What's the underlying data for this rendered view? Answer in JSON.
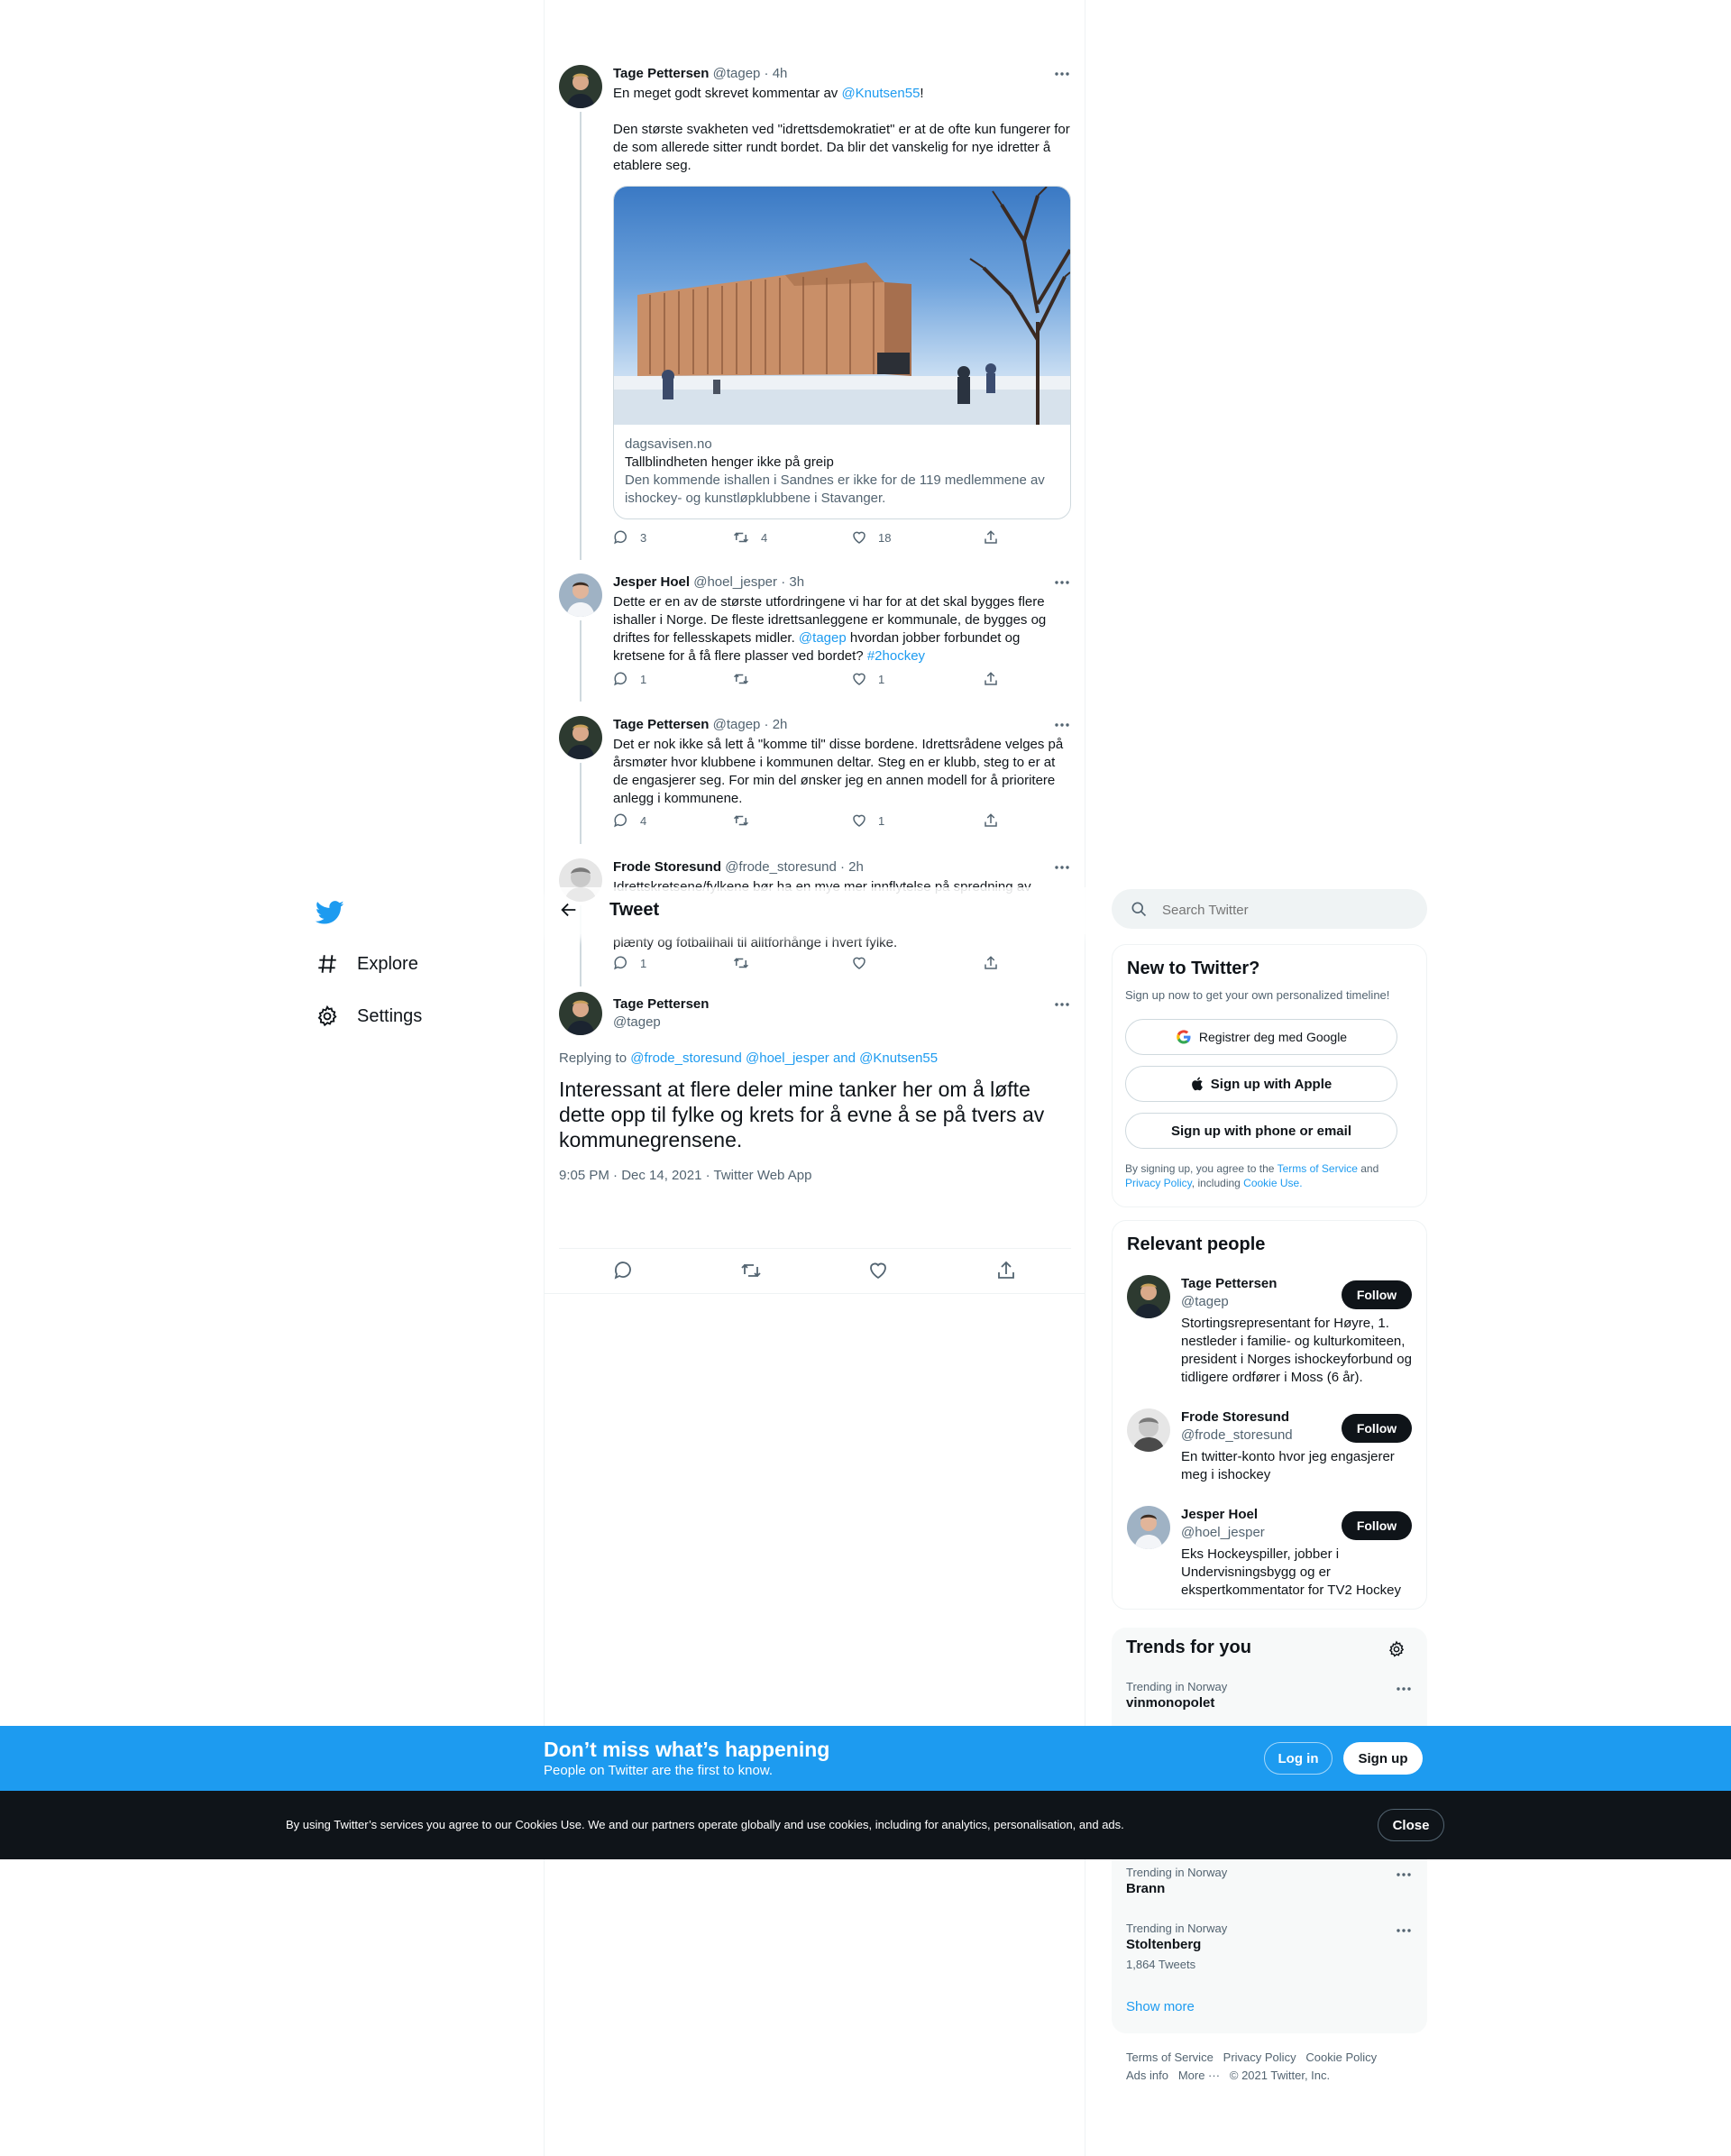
{
  "nav": {
    "logo": "twitter-bird-icon",
    "items": [
      {
        "label": "Explore",
        "icon": "hashtag-icon"
      },
      {
        "label": "Settings",
        "icon": "gear-icon"
      }
    ]
  },
  "header": {
    "title": "Tweet"
  },
  "thread": [
    {
      "name": "Tage Pettersen",
      "handle": "@tagep",
      "time": "· 4h",
      "text_before": "En meget godt skrevet kommentar av ",
      "mention": "@Knutsen55",
      "text_after": "!\n\nDen største svakheten ved \"idrettsdemokratiet\" er at de ofte kun fungerer for de som allerede sitter rundt bordet. Da blir det vanskelig for nye idretter å etablere seg.",
      "card": {
        "domain": "dagsavisen.no",
        "title": "Tallblindheten henger ikke på greip",
        "description": "Den kommende ishallen i Sandnes er ikke for de 119 medlemmene av ishockey- og kunstløpklubbene i Stavanger."
      },
      "replies": "3",
      "retweets": "4",
      "likes": "18"
    },
    {
      "name": "Jesper Hoel",
      "handle": "@hoel_jesper",
      "time": "· 3h",
      "text_before": "Dette er en av de største utfordringene vi har for at det skal bygges flere ishaller i Norge. De fleste idrettsanleggene er kommunale, de bygges og driftes for fellesskapets midler. ",
      "mention": "@tagep",
      "text_mid": " hvordan jobber forbundet og kretsene for å få flere plasser ved bordet? ",
      "hashtag": "#2hockey",
      "replies": "1",
      "retweets": "",
      "likes": "1"
    },
    {
      "name": "Tage Pettersen",
      "handle": "@tagep",
      "time": "· 2h",
      "text": "Det er nok ikke så lett å \"komme til\" disse bordene. Idrettsrådene velges på årsmøter hvor klubbene i kommunen deltar. Steg en er klubb, steg to er at de engasjerer seg. For min del ønsker jeg en annen modell for å prioritere anlegg i kommunene.",
      "replies": "4",
      "retweets": "",
      "likes": "1"
    },
    {
      "name": "Frode Storesund",
      "handle": "@frode_storesund",
      "time": "· 2h",
      "text_top": "Idrettskretsene/fylkene bør ha en mye mer innflytelse på spredning av",
      "text_bottom": "plænty og fotballhall til alltforhånge i hvert fylke.",
      "replies": "1",
      "retweets": "",
      "likes": ""
    }
  ],
  "main_tweet": {
    "name": "Tage Pettersen",
    "handle": "@tagep",
    "replying_label": "Replying to ",
    "replying_to": "@frode_storesund @hoel_jesper and @Knutsen55",
    "text": "Interessant at flere deler mine tanker her om å løfte dette opp til fylke og krets for å evne å se på tvers av kommunegrensene.",
    "meta": "9:05 PM · Dec 14, 2021 · Twitter Web App"
  },
  "search": {
    "placeholder": "Search Twitter"
  },
  "signup": {
    "title": "New to Twitter?",
    "subtitle": "Sign up now to get your own personalized timeline!",
    "google": "Registrer deg med Google",
    "apple": "Sign up with Apple",
    "phone": "Sign up with phone or email",
    "legal_1": "By signing up, you agree to the ",
    "tos": "Terms of Service",
    "legal_2": " and",
    "privacy": "Privacy Policy",
    "legal_3": ", including ",
    "cookie": "Cookie Use."
  },
  "relevant": {
    "title": "Relevant people",
    "follow_label": "Follow",
    "people": [
      {
        "name": "Tage Pettersen",
        "handle": "@tagep",
        "bio": "Stortingsrepresentant for Høyre, 1. nestleder i familie- og kulturkomiteen, president i Norges ishockeyforbund og tidligere ordfører i Moss (6 år)."
      },
      {
        "name": "Frode Storesund",
        "handle": "@frode_storesund",
        "bio": "En twitter-konto hvor jeg engasjerer meg i ishockey"
      },
      {
        "name": "Jesper Hoel",
        "handle": "@hoel_jesper",
        "bio": "Eks Hockeyspiller, jobber i Undervisningsbygg og er ekspertkommentator for TV2 Hockey"
      }
    ]
  },
  "trends": {
    "title": "Trends for you",
    "items": [
      {
        "category": "Trending in Norway",
        "name": "vinmonopolet",
        "count": ""
      },
      {
        "category": "Trending in Norway",
        "name": "Brann",
        "count": ""
      },
      {
        "category": "Trending in Norway",
        "name": "Stoltenberg",
        "count": "1,864 Tweets"
      }
    ],
    "show_more": "Show more"
  },
  "footer": {
    "links": [
      "Terms of Service",
      "Privacy Policy",
      "Cookie Policy",
      "Ads info",
      "More ···"
    ],
    "copyright": "© 2021 Twitter, Inc."
  },
  "banner": {
    "title": "Don’t miss what’s happening",
    "subtitle": "People on Twitter are the first to know.",
    "login": "Log in",
    "signup": "Sign up"
  },
  "cookie_bar": {
    "text": "By using Twitter’s services you agree to our Cookies Use. We and our partners operate globally and use cookies, including for analytics, personalisation, and ads.",
    "close": "Close"
  },
  "colors": {
    "accent": "#1d9bf0",
    "text": "#0f1419",
    "muted": "#536471",
    "dark": "#0f1419"
  }
}
